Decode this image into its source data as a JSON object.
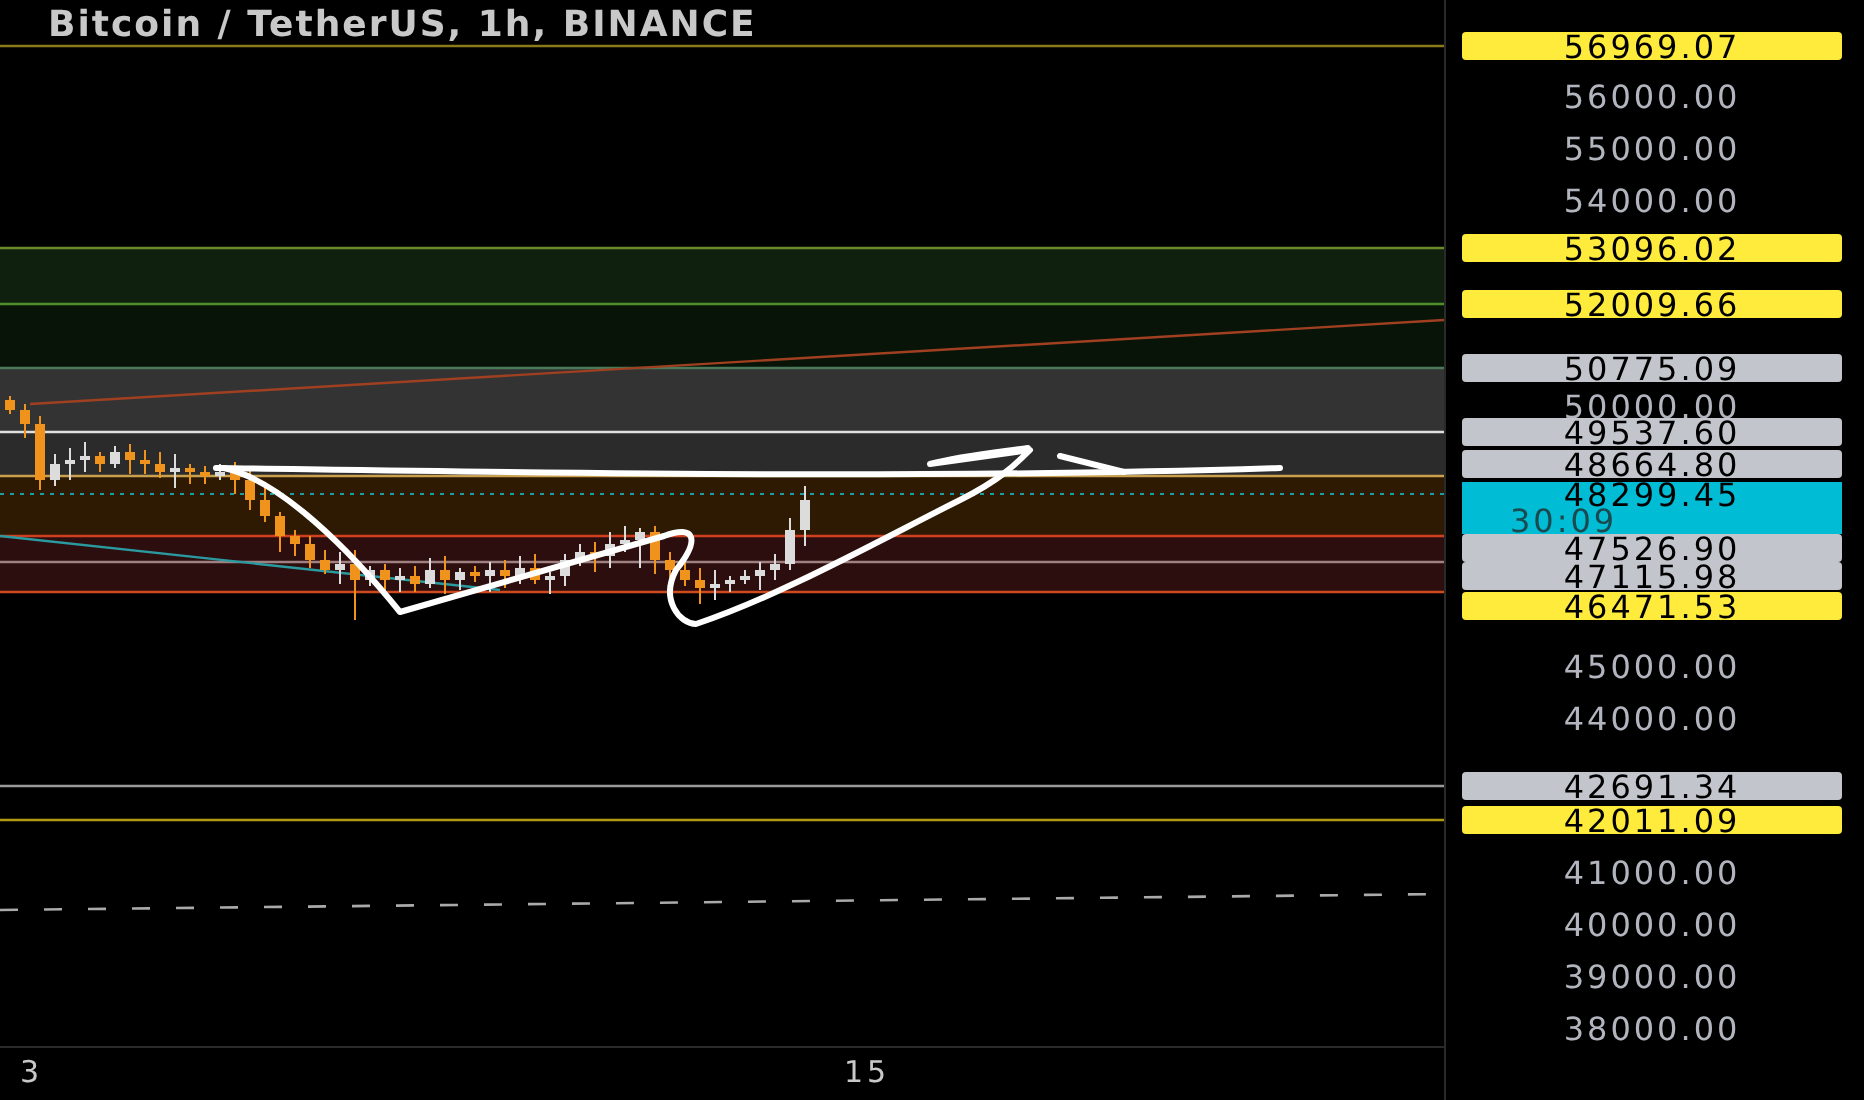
{
  "title": "Bitcoin / TetherUS, 1h, BINANCE",
  "price_axis": [
    {
      "kind": "yellow",
      "text": "56969.07"
    },
    {
      "kind": "tick",
      "text": "56000.00"
    },
    {
      "kind": "tick",
      "text": "55000.00"
    },
    {
      "kind": "tick",
      "text": "54000.00"
    },
    {
      "kind": "yellow",
      "text": "53096.02"
    },
    {
      "kind": "yellow",
      "text": "52009.66"
    },
    {
      "kind": "grey",
      "text": "50775.09"
    },
    {
      "kind": "tick",
      "text": "50000.00"
    },
    {
      "kind": "grey",
      "text": "49537.60"
    },
    {
      "kind": "grey",
      "text": "48664.80"
    },
    {
      "kind": "current",
      "text": "48299.45",
      "countdown": "30:09"
    },
    {
      "kind": "grey",
      "text": "47526.90"
    },
    {
      "kind": "grey",
      "text": "47115.98"
    },
    {
      "kind": "yellow",
      "text": "46471.53"
    },
    {
      "kind": "tick",
      "text": "45000.00"
    },
    {
      "kind": "tick",
      "text": "44000.00"
    },
    {
      "kind": "grey",
      "text": "42691.34"
    },
    {
      "kind": "yellow",
      "text": "42011.09"
    },
    {
      "kind": "tick",
      "text": "41000.00"
    },
    {
      "kind": "tick",
      "text": "40000.00"
    },
    {
      "kind": "tick",
      "text": "39000.00"
    },
    {
      "kind": "tick",
      "text": "38000.00"
    }
  ],
  "time_axis": [
    "3",
    "15"
  ]
}
